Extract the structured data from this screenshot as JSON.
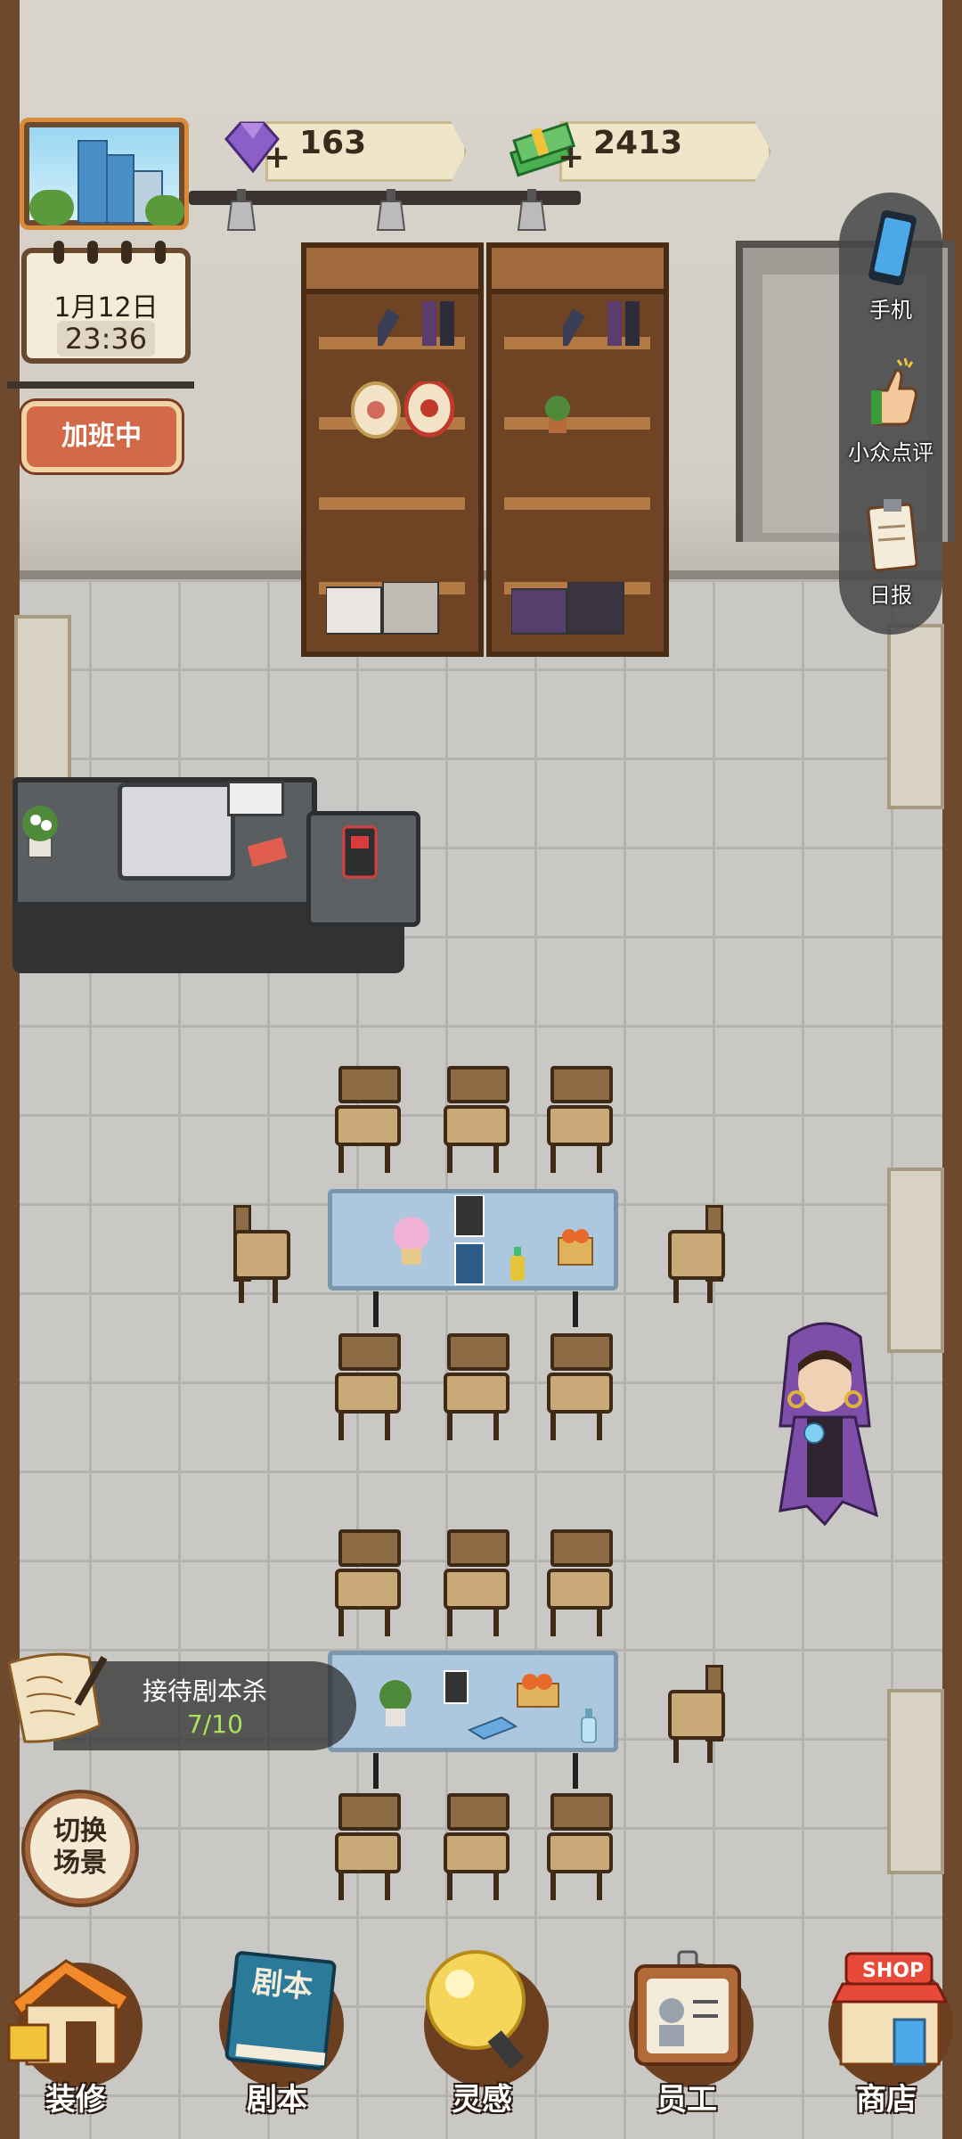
{
  "hud": {
    "currency": [
      {
        "name": "gems",
        "value": "163",
        "color": "#8b5fc7",
        "icon": "purple-gem-icon"
      },
      {
        "name": "cash",
        "value": "2413",
        "color": "#4caf50",
        "icon": "cash-stack-icon"
      }
    ],
    "calendar": {
      "date": "1月12日",
      "time": "23:36"
    },
    "overtime_label": "加班中"
  },
  "side_menu": [
    {
      "id": "phone",
      "label": "手机",
      "icon": "smartphone-icon"
    },
    {
      "id": "review",
      "label": "小众点评",
      "icon": "thumbs-up-icon"
    },
    {
      "id": "daily",
      "label": "日报",
      "icon": "clipboard-icon"
    }
  ],
  "task": {
    "name": "接待剧本杀",
    "progress": "7/10"
  },
  "switch_scene": {
    "line1": "切换",
    "line2": "场景"
  },
  "bottom_nav": [
    {
      "id": "decorate",
      "label": "装修",
      "icon": "house-icon"
    },
    {
      "id": "script",
      "label": "剧本",
      "icon": "script-book-icon",
      "book_title": "剧本"
    },
    {
      "id": "inspiration",
      "label": "灵感",
      "icon": "lightbulb-icon"
    },
    {
      "id": "staff",
      "label": "员工",
      "icon": "id-badge-icon"
    },
    {
      "id": "shop",
      "label": "商店",
      "icon": "shop-icon",
      "sign": "SHOP"
    }
  ],
  "colors": {
    "accent_orange": "#d98b3a",
    "overtime_red": "#d26a4a",
    "progress_green": "#a6e45a"
  }
}
